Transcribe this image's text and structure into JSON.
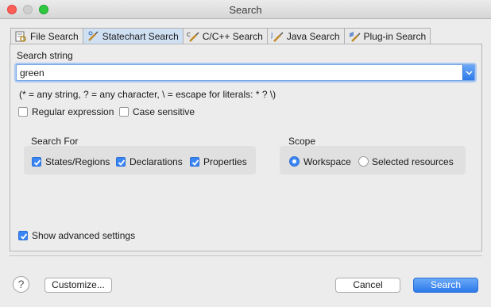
{
  "window": {
    "title": "Search"
  },
  "tabs": [
    {
      "label": "File Search",
      "icon": "file-search-icon",
      "active": false
    },
    {
      "label": "Statechart Search",
      "icon": "statechart-search-icon",
      "active": true
    },
    {
      "label": "C/C++ Search",
      "icon": "cpp-search-icon",
      "active": false
    },
    {
      "label": "Java Search",
      "icon": "java-search-icon",
      "active": false
    },
    {
      "label": "Plug-in Search",
      "icon": "plugin-search-icon",
      "active": false
    }
  ],
  "search": {
    "label": "Search string",
    "value": "green",
    "hint": "(* = any string, ? = any character, \\ = escape for literals: * ? \\)"
  },
  "options": {
    "regex_label": "Regular expression",
    "regex_checked": false,
    "case_label": "Case sensitive",
    "case_checked": false
  },
  "search_for": {
    "title": "Search For",
    "items": [
      {
        "label": "States/Regions",
        "checked": true
      },
      {
        "label": "Declarations",
        "checked": true
      },
      {
        "label": "Properties",
        "checked": true
      }
    ]
  },
  "scope": {
    "title": "Scope",
    "items": [
      {
        "label": "Workspace",
        "selected": true
      },
      {
        "label": "Selected resources",
        "selected": false
      }
    ]
  },
  "advanced": {
    "label": "Show advanced settings",
    "checked": true
  },
  "footer": {
    "help_glyph": "?",
    "customize_label": "Customize...",
    "cancel_label": "Cancel",
    "search_label": "Search"
  },
  "colors": {
    "accent": "#3a86f4",
    "active_tab": "#cfe0f3"
  }
}
